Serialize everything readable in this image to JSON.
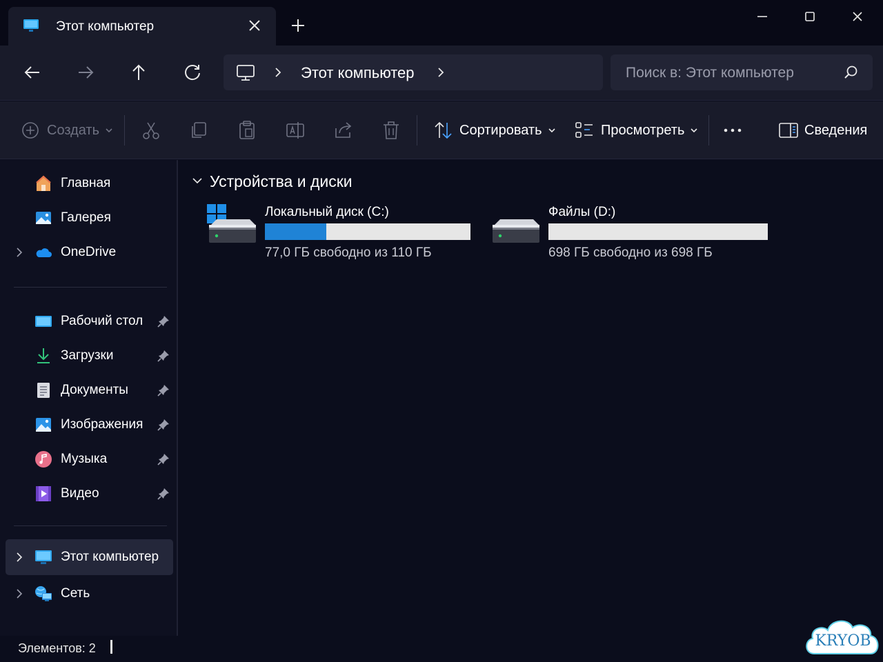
{
  "window": {
    "tab_title": "Этот компьютер"
  },
  "navigation": {
    "address_path": "Этот компьютер",
    "search_placeholder": "Поиск в: Этот компьютер"
  },
  "commands": {
    "create_label": "Создать",
    "sort_label": "Сортировать",
    "view_label": "Просмотреть",
    "details_label": "Сведения"
  },
  "sidebar": {
    "top_items": [
      {
        "label": "Главная",
        "icon": "home-icon"
      },
      {
        "label": "Галерея",
        "icon": "gallery-icon"
      },
      {
        "label": "OneDrive",
        "icon": "cloud-icon"
      }
    ],
    "pinned_items": [
      {
        "label": "Рабочий стол",
        "icon": "desktop-folder-icon"
      },
      {
        "label": "Загрузки",
        "icon": "downloads-icon"
      },
      {
        "label": "Документы",
        "icon": "documents-icon"
      },
      {
        "label": "Изображения",
        "icon": "pictures-icon"
      },
      {
        "label": "Музыка",
        "icon": "music-icon"
      },
      {
        "label": "Видео",
        "icon": "video-icon"
      }
    ],
    "bottom_items": [
      {
        "label": "Этот компьютер",
        "icon": "this-pc-icon",
        "selected": true
      },
      {
        "label": "Сеть",
        "icon": "network-icon"
      }
    ]
  },
  "content": {
    "group_title": "Устройства и диски",
    "drives": [
      {
        "name": "Локальный диск (C:)",
        "info": "77,0 ГБ свободно из 110 ГБ",
        "used_fraction": 0.3,
        "icon": "system-drive-icon"
      },
      {
        "name": "Файлы (D:)",
        "info": "698 ГБ свободно из 698 ГБ",
        "used_fraction": 0.0,
        "icon": "drive-icon"
      }
    ]
  },
  "status": {
    "items_count": "Элементов: 2"
  },
  "watermark": "KRYOB",
  "colors": {
    "accent": "#1f83d6",
    "background": "#0b0d1c",
    "toolbar": "#191b2a"
  }
}
